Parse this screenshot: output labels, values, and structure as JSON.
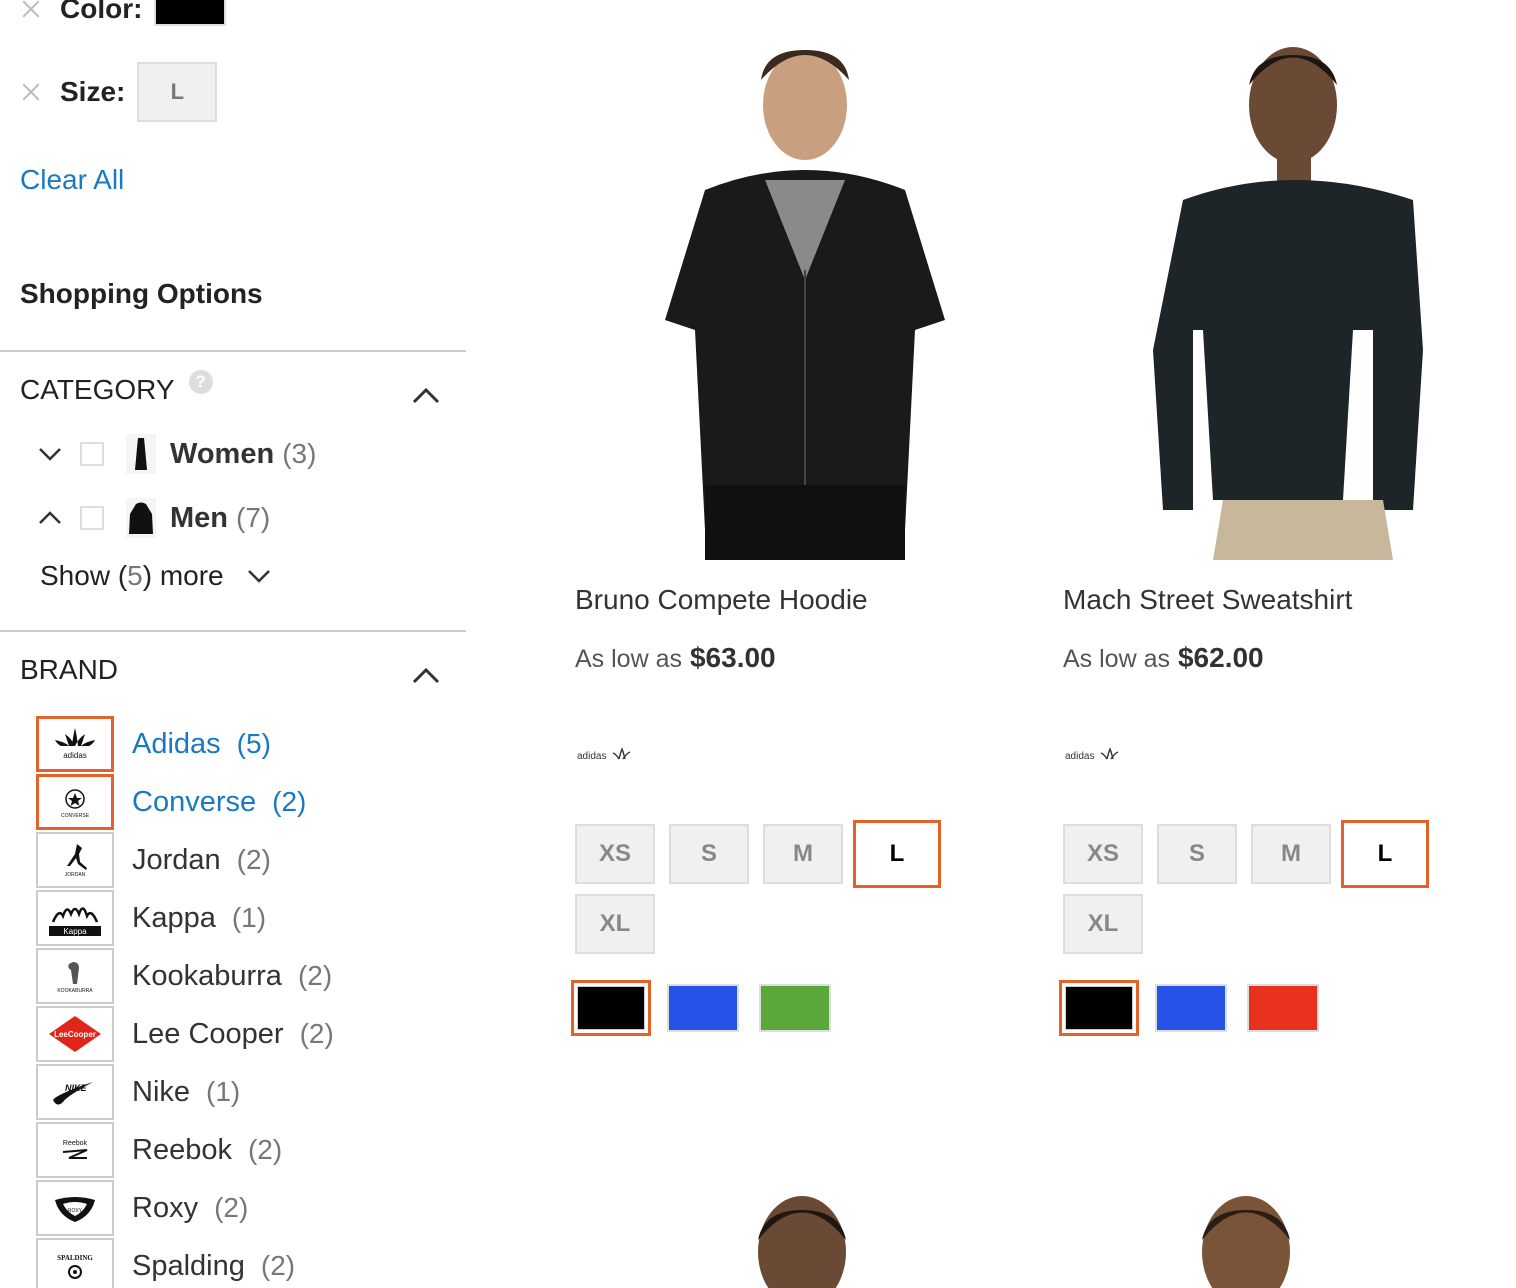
{
  "filters": {
    "color_label": "Color:",
    "color_value": "#000000",
    "size_label": "Size:",
    "size_value": "L",
    "clear_all": "Clear All"
  },
  "sidebar": {
    "title": "Shopping Options",
    "category": {
      "title": "CATEGORY",
      "help": "?",
      "items": [
        {
          "name": "Women",
          "count": "(3)"
        },
        {
          "name": "Men",
          "count": "(7)"
        }
      ],
      "show_more_prefix": "Show (",
      "show_more_num": "5",
      "show_more_suffix": ") more"
    },
    "brand": {
      "title": "BRAND",
      "items": [
        {
          "name": "Adidas",
          "count": "(5)",
          "logo": "adidas",
          "logo_text": "adidas"
        },
        {
          "name": "Converse",
          "count": "(2)",
          "logo": "converse",
          "logo_text": "CONVERSE"
        },
        {
          "name": "Jordan",
          "count": "(2)",
          "logo": "jordan",
          "logo_text": "JORDAN"
        },
        {
          "name": "Kappa",
          "count": "(1)",
          "logo": "kappa",
          "logo_text": "Kappa"
        },
        {
          "name": "Kookaburra",
          "count": "(2)",
          "logo": "kookaburra",
          "logo_text": "KOOKABURRA"
        },
        {
          "name": "Lee Cooper",
          "count": "(2)",
          "logo": "lee-cooper",
          "logo_text": "LeeCooper"
        },
        {
          "name": "Nike",
          "count": "(1)",
          "logo": "nike",
          "logo_text": "NIKE"
        },
        {
          "name": "Reebok",
          "count": "(2)",
          "logo": "reebok",
          "logo_text": "Reebok"
        },
        {
          "name": "Roxy",
          "count": "(2)",
          "logo": "roxy",
          "logo_text": "ROXY"
        },
        {
          "name": "Spalding",
          "count": "(2)",
          "logo": "spalding",
          "logo_text": "SPALDING"
        }
      ]
    }
  },
  "products": [
    {
      "name": "Bruno Compete Hoodie",
      "price_prefix": "As low as",
      "price": "$63.00",
      "brand_logo_text": "adidas",
      "sizes": [
        "XS",
        "S",
        "M",
        "L",
        "XL"
      ],
      "colors": [
        "#000000",
        "#2952e8",
        "#5aa83a"
      ]
    },
    {
      "name": "Mach Street Sweatshirt",
      "price_prefix": "As low as",
      "price": "$62.00",
      "brand_logo_text": "adidas",
      "sizes": [
        "XS",
        "S",
        "M",
        "L",
        "XL"
      ],
      "colors": [
        "#000000",
        "#2952e8",
        "#e8321e"
      ]
    }
  ]
}
